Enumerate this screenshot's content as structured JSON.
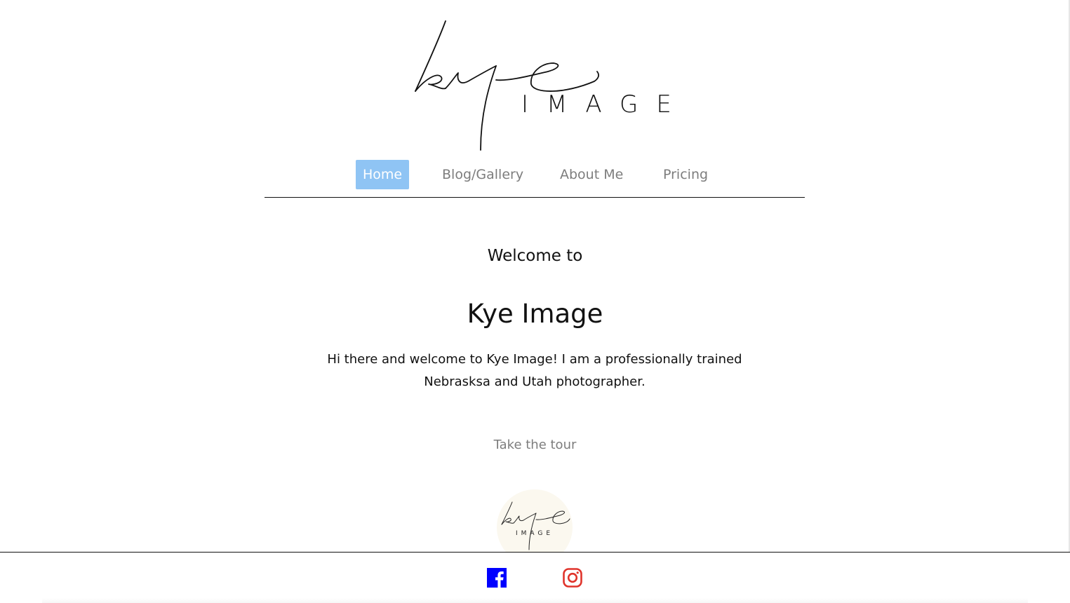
{
  "brand": {
    "logo_script": "kye",
    "logo_word": "IMAGE"
  },
  "nav": {
    "items": [
      {
        "label": "Home",
        "active": true
      },
      {
        "label": "Blog/Gallery",
        "active": false
      },
      {
        "label": "About Me",
        "active": false
      },
      {
        "label": "Pricing",
        "active": false
      }
    ]
  },
  "main": {
    "welcome": "Welcome to",
    "title": "Kye Image",
    "intro": "Hi there and welcome to Kye Image! I am a professionally trained Nebrasksa and Utah photographer.",
    "tour_link": "Take the tour"
  },
  "footer": {
    "social": [
      {
        "icon": "facebook-icon",
        "color": "#0000ff"
      },
      {
        "icon": "instagram-icon",
        "color": "#e0342b"
      }
    ]
  },
  "colors": {
    "accent": "#8fc4f4",
    "nav_text": "#7d7d7d",
    "text": "#111111"
  }
}
